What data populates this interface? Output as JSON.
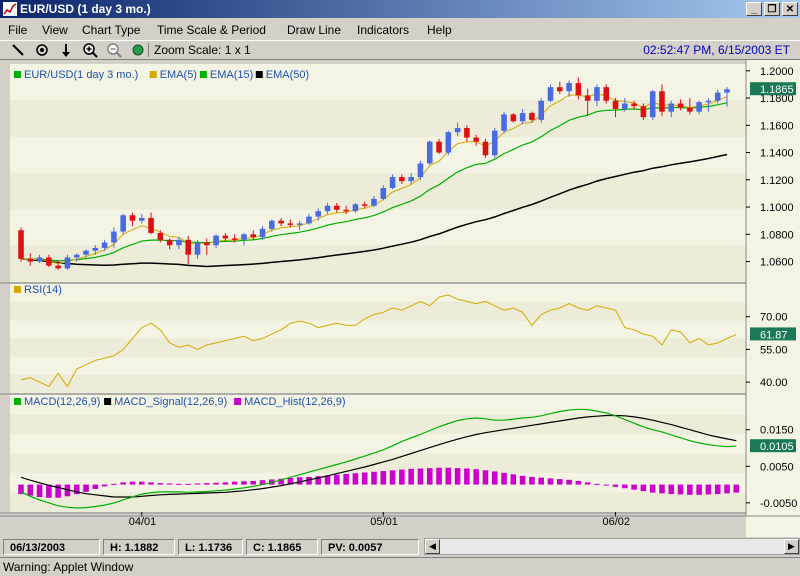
{
  "window": {
    "title": "EUR/USD (1 day  3 mo.)"
  },
  "menu": [
    "File",
    "View",
    "Chart Type",
    "Time Scale & Period",
    "Draw Line",
    "Indicators",
    "Help"
  ],
  "toolbar": {
    "tools": [
      "draw-line-icon",
      "crosshair-icon",
      "arrow-down-icon",
      "zoom-in-icon",
      "zoom-out-icon",
      "globe-icon"
    ],
    "zoom_label": "Zoom Scale: 1 x 1",
    "clock": "02:52:47 PM, 6/15/2003 ET"
  },
  "status": {
    "date": "06/13/2003",
    "high": "H: 1.1882",
    "low": "L: 1.1736",
    "close": "C: 1.1865",
    "pv": "PV: 0.0057"
  },
  "warning": "Warning: Applet Window",
  "colors": {
    "up": "#4a6be0",
    "down": "#dd1111",
    "ema5": "#d4aa00",
    "ema15": "#00b000",
    "ema50": "#000000",
    "rsi": "#d4aa00",
    "macd": "#00b000",
    "signal": "#000000",
    "hist": "#cc00cc",
    "band_light": "#f4f4e4",
    "band_dark": "#ececd8"
  },
  "chart_data": [
    {
      "type": "candlestick",
      "panel": "price",
      "legend": [
        "EUR/USD(1 day  3 mo.)",
        "EMA(5)",
        "EMA(15)",
        "EMA(50)"
      ],
      "ylim": [
        1.045,
        1.205
      ],
      "yticks": [
        1.2,
        1.18,
        1.16,
        1.14,
        1.12,
        1.1,
        1.08,
        1.06
      ],
      "last_value_label": "1.1865",
      "last_value": 1.1865,
      "x_dates": [
        "04/01",
        "05/01",
        "06/02"
      ],
      "x_date_index": [
        13,
        39,
        64
      ],
      "candles": [
        [
          1.083,
          1.085,
          1.06,
          1.062
        ],
        [
          1.062,
          1.066,
          1.057,
          1.06
        ],
        [
          1.06,
          1.065,
          1.059,
          1.063
        ],
        [
          1.063,
          1.065,
          1.056,
          1.057
        ],
        [
          1.057,
          1.061,
          1.054,
          1.055
        ],
        [
          1.055,
          1.065,
          1.054,
          1.063
        ],
        [
          1.063,
          1.066,
          1.06,
          1.065
        ],
        [
          1.065,
          1.069,
          1.063,
          1.068
        ],
        [
          1.068,
          1.072,
          1.065,
          1.07
        ],
        [
          1.07,
          1.076,
          1.068,
          1.074
        ],
        [
          1.074,
          1.085,
          1.07,
          1.082
        ],
        [
          1.082,
          1.095,
          1.08,
          1.094
        ],
        [
          1.094,
          1.096,
          1.086,
          1.09
        ],
        [
          1.09,
          1.095,
          1.088,
          1.092
        ],
        [
          1.092,
          1.096,
          1.08,
          1.081
        ],
        [
          1.081,
          1.083,
          1.074,
          1.076
        ],
        [
          1.076,
          1.077,
          1.069,
          1.072
        ],
        [
          1.072,
          1.078,
          1.069,
          1.076
        ],
        [
          1.076,
          1.079,
          1.058,
          1.065
        ],
        [
          1.065,
          1.076,
          1.062,
          1.074
        ],
        [
          1.074,
          1.077,
          1.065,
          1.072
        ],
        [
          1.072,
          1.08,
          1.07,
          1.079
        ],
        [
          1.079,
          1.081,
          1.075,
          1.077
        ],
        [
          1.077,
          1.08,
          1.074,
          1.076
        ],
        [
          1.076,
          1.081,
          1.072,
          1.08
        ],
        [
          1.08,
          1.083,
          1.076,
          1.078
        ],
        [
          1.078,
          1.086,
          1.076,
          1.084
        ],
        [
          1.084,
          1.091,
          1.082,
          1.09
        ],
        [
          1.09,
          1.092,
          1.086,
          1.088
        ],
        [
          1.088,
          1.091,
          1.085,
          1.087
        ],
        [
          1.087,
          1.09,
          1.083,
          1.088
        ],
        [
          1.088,
          1.095,
          1.087,
          1.093
        ],
        [
          1.093,
          1.099,
          1.09,
          1.097
        ],
        [
          1.097,
          1.103,
          1.095,
          1.101
        ],
        [
          1.101,
          1.103,
          1.096,
          1.098
        ],
        [
          1.098,
          1.101,
          1.095,
          1.097
        ],
        [
          1.097,
          1.103,
          1.096,
          1.102
        ],
        [
          1.102,
          1.104,
          1.099,
          1.101
        ],
        [
          1.101,
          1.108,
          1.1,
          1.106
        ],
        [
          1.106,
          1.116,
          1.105,
          1.114
        ],
        [
          1.114,
          1.124,
          1.113,
          1.122
        ],
        [
          1.122,
          1.124,
          1.117,
          1.119
        ],
        [
          1.119,
          1.125,
          1.117,
          1.122
        ],
        [
          1.122,
          1.134,
          1.12,
          1.132
        ],
        [
          1.132,
          1.149,
          1.131,
          1.148
        ],
        [
          1.148,
          1.15,
          1.139,
          1.14
        ],
        [
          1.14,
          1.156,
          1.138,
          1.155
        ],
        [
          1.155,
          1.162,
          1.152,
          1.158
        ],
        [
          1.158,
          1.16,
          1.148,
          1.151
        ],
        [
          1.151,
          1.153,
          1.145,
          1.148
        ],
        [
          1.148,
          1.15,
          1.136,
          1.138
        ],
        [
          1.138,
          1.158,
          1.136,
          1.156
        ],
        [
          1.156,
          1.17,
          1.154,
          1.168
        ],
        [
          1.168,
          1.169,
          1.162,
          1.163
        ],
        [
          1.163,
          1.172,
          1.161,
          1.169
        ],
        [
          1.169,
          1.17,
          1.162,
          1.164
        ],
        [
          1.164,
          1.18,
          1.162,
          1.178
        ],
        [
          1.178,
          1.19,
          1.177,
          1.188
        ],
        [
          1.188,
          1.192,
          1.183,
          1.185
        ],
        [
          1.185,
          1.193,
          1.181,
          1.191
        ],
        [
          1.191,
          1.195,
          1.179,
          1.182
        ],
        [
          1.182,
          1.187,
          1.167,
          1.178
        ],
        [
          1.178,
          1.19,
          1.174,
          1.188
        ],
        [
          1.188,
          1.19,
          1.176,
          1.178
        ],
        [
          1.178,
          1.18,
          1.166,
          1.172
        ],
        [
          1.172,
          1.18,
          1.17,
          1.176
        ],
        [
          1.176,
          1.178,
          1.172,
          1.174
        ],
        [
          1.174,
          1.176,
          1.164,
          1.166
        ],
        [
          1.166,
          1.186,
          1.164,
          1.185
        ],
        [
          1.185,
          1.19,
          1.167,
          1.17
        ],
        [
          1.17,
          1.178,
          1.166,
          1.176
        ],
        [
          1.176,
          1.179,
          1.171,
          1.173
        ],
        [
          1.173,
          1.18,
          1.168,
          1.17
        ],
        [
          1.17,
          1.178,
          1.168,
          1.177
        ],
        [
          1.177,
          1.18,
          1.17,
          1.178
        ],
        [
          1.178,
          1.186,
          1.176,
          1.184
        ],
        [
          1.184,
          1.1882,
          1.1736,
          1.1865
        ]
      ]
    },
    {
      "type": "line",
      "panel": "rsi",
      "legend": [
        "RSI(14)"
      ],
      "ylim": [
        35,
        85
      ],
      "yticks": [
        70,
        55,
        40
      ],
      "last_value_label": "61.87",
      "values": [
        41,
        42,
        40,
        38,
        44,
        38,
        46,
        48,
        50,
        51,
        52,
        55,
        60,
        65,
        67,
        64,
        58,
        56,
        57,
        55,
        57,
        58,
        59,
        60,
        61,
        59,
        60,
        62,
        64,
        67,
        68,
        67,
        65,
        66,
        67,
        66,
        66,
        69,
        71,
        72,
        74,
        73,
        75,
        77,
        75,
        79,
        80,
        78,
        77,
        76,
        77,
        75,
        73,
        74,
        72,
        66,
        71,
        73,
        74,
        76,
        74,
        73,
        75,
        74,
        73,
        65,
        64,
        62,
        61,
        57,
        64,
        63,
        58,
        60,
        57,
        58,
        60,
        61.87
      ]
    },
    {
      "type": "line",
      "panel": "macd",
      "legend": [
        "MACD(12,26,9)",
        "MACD_Signal(12,26,9)",
        "MACD_Hist(12,26,9)"
      ],
      "ylim": [
        -0.0075,
        0.0245
      ],
      "yticks": [
        0.015,
        0.005,
        -0.005
      ],
      "last_value_label": "0.0105",
      "series": [
        {
          "name": "MACD(12,26,9)",
          "values": [
            -0.002,
            -0.0032,
            -0.0042,
            -0.005,
            -0.0058,
            -0.0062,
            -0.0064,
            -0.0063,
            -0.006,
            -0.0056,
            -0.005,
            -0.0042,
            -0.0034,
            -0.0026,
            -0.0022,
            -0.002,
            -0.002,
            -0.002,
            -0.0021,
            -0.002,
            -0.0019,
            -0.0017,
            -0.0015,
            -0.0012,
            -0.0009,
            -0.0005,
            0.0,
            0.0006,
            0.0013,
            0.002,
            0.0027,
            0.0034,
            0.0041,
            0.0048,
            0.0055,
            0.0062,
            0.007,
            0.0078,
            0.0086,
            0.0095,
            0.0106,
            0.0118,
            0.0128,
            0.0137,
            0.0148,
            0.0158,
            0.0167,
            0.0175,
            0.018,
            0.0182,
            0.018,
            0.0176,
            0.0176,
            0.0179,
            0.0182,
            0.0184,
            0.0188,
            0.0194,
            0.02,
            0.0204,
            0.0206,
            0.0205,
            0.0201,
            0.0196,
            0.0188,
            0.0178,
            0.0168,
            0.0158,
            0.015,
            0.0144,
            0.0136,
            0.0128,
            0.012,
            0.0114,
            0.0109,
            0.0106,
            0.0104,
            0.0105
          ]
        },
        {
          "name": "MACD_Signal(12,26,9)",
          "values": [
            0.002,
            0.0012,
            0.0005,
            -0.0002,
            -0.0008,
            -0.0014,
            -0.002,
            -0.0025,
            -0.0028,
            -0.0031,
            -0.0034,
            -0.0034,
            -0.0034,
            -0.0032,
            -0.003,
            -0.0028,
            -0.0027,
            -0.0026,
            -0.0025,
            -0.0024,
            -0.0023,
            -0.0022,
            -0.0021,
            -0.0019,
            -0.0017,
            -0.0014,
            -0.0011,
            -0.0007,
            -0.0003,
            0.0002,
            0.0007,
            0.0013,
            0.0018,
            0.0024,
            0.003,
            0.0036,
            0.0042,
            0.0048,
            0.0055,
            0.0062,
            0.0069,
            0.0077,
            0.0085,
            0.0093,
            0.0101,
            0.0109,
            0.0117,
            0.0124,
            0.0131,
            0.0137,
            0.0142,
            0.0146,
            0.015,
            0.0154,
            0.0158,
            0.0162,
            0.0166,
            0.017,
            0.0174,
            0.0178,
            0.0182,
            0.0185,
            0.0187,
            0.0189,
            0.0189,
            0.0188,
            0.0185,
            0.0181,
            0.0176,
            0.017,
            0.0164,
            0.0157,
            0.015,
            0.0143,
            0.0136,
            0.013,
            0.0125,
            0.012
          ]
        },
        {
          "name": "MACD_Hist(12,26,9)",
          "values": [
            -0.0026,
            -0.003,
            -0.0034,
            -0.0036,
            -0.0036,
            -0.0032,
            -0.0026,
            -0.002,
            -0.0012,
            -0.0005,
            0.0002,
            0.0006,
            0.0008,
            0.0008,
            0.0006,
            0.0004,
            0.0003,
            0.0002,
            0.0002,
            0.0003,
            0.0004,
            0.0005,
            0.0006,
            0.0008,
            0.0009,
            0.001,
            0.0012,
            0.0014,
            0.0016,
            0.0018,
            0.002,
            0.0021,
            0.0023,
            0.0025,
            0.0027,
            0.0029,
            0.0031,
            0.0033,
            0.0035,
            0.0037,
            0.0039,
            0.0041,
            0.0043,
            0.0044,
            0.0045,
            0.0046,
            0.0046,
            0.0045,
            0.0044,
            0.0042,
            0.0039,
            0.0036,
            0.0032,
            0.0028,
            0.0024,
            0.0021,
            0.0019,
            0.0017,
            0.0015,
            0.0013,
            0.001,
            0.0006,
            0.0002,
            -0.0002,
            -0.0006,
            -0.001,
            -0.0014,
            -0.0018,
            -0.0022,
            -0.0024,
            -0.0026,
            -0.0027,
            -0.0028,
            -0.0028,
            -0.0027,
            -0.0026,
            -0.0024,
            -0.0022
          ]
        }
      ]
    }
  ]
}
